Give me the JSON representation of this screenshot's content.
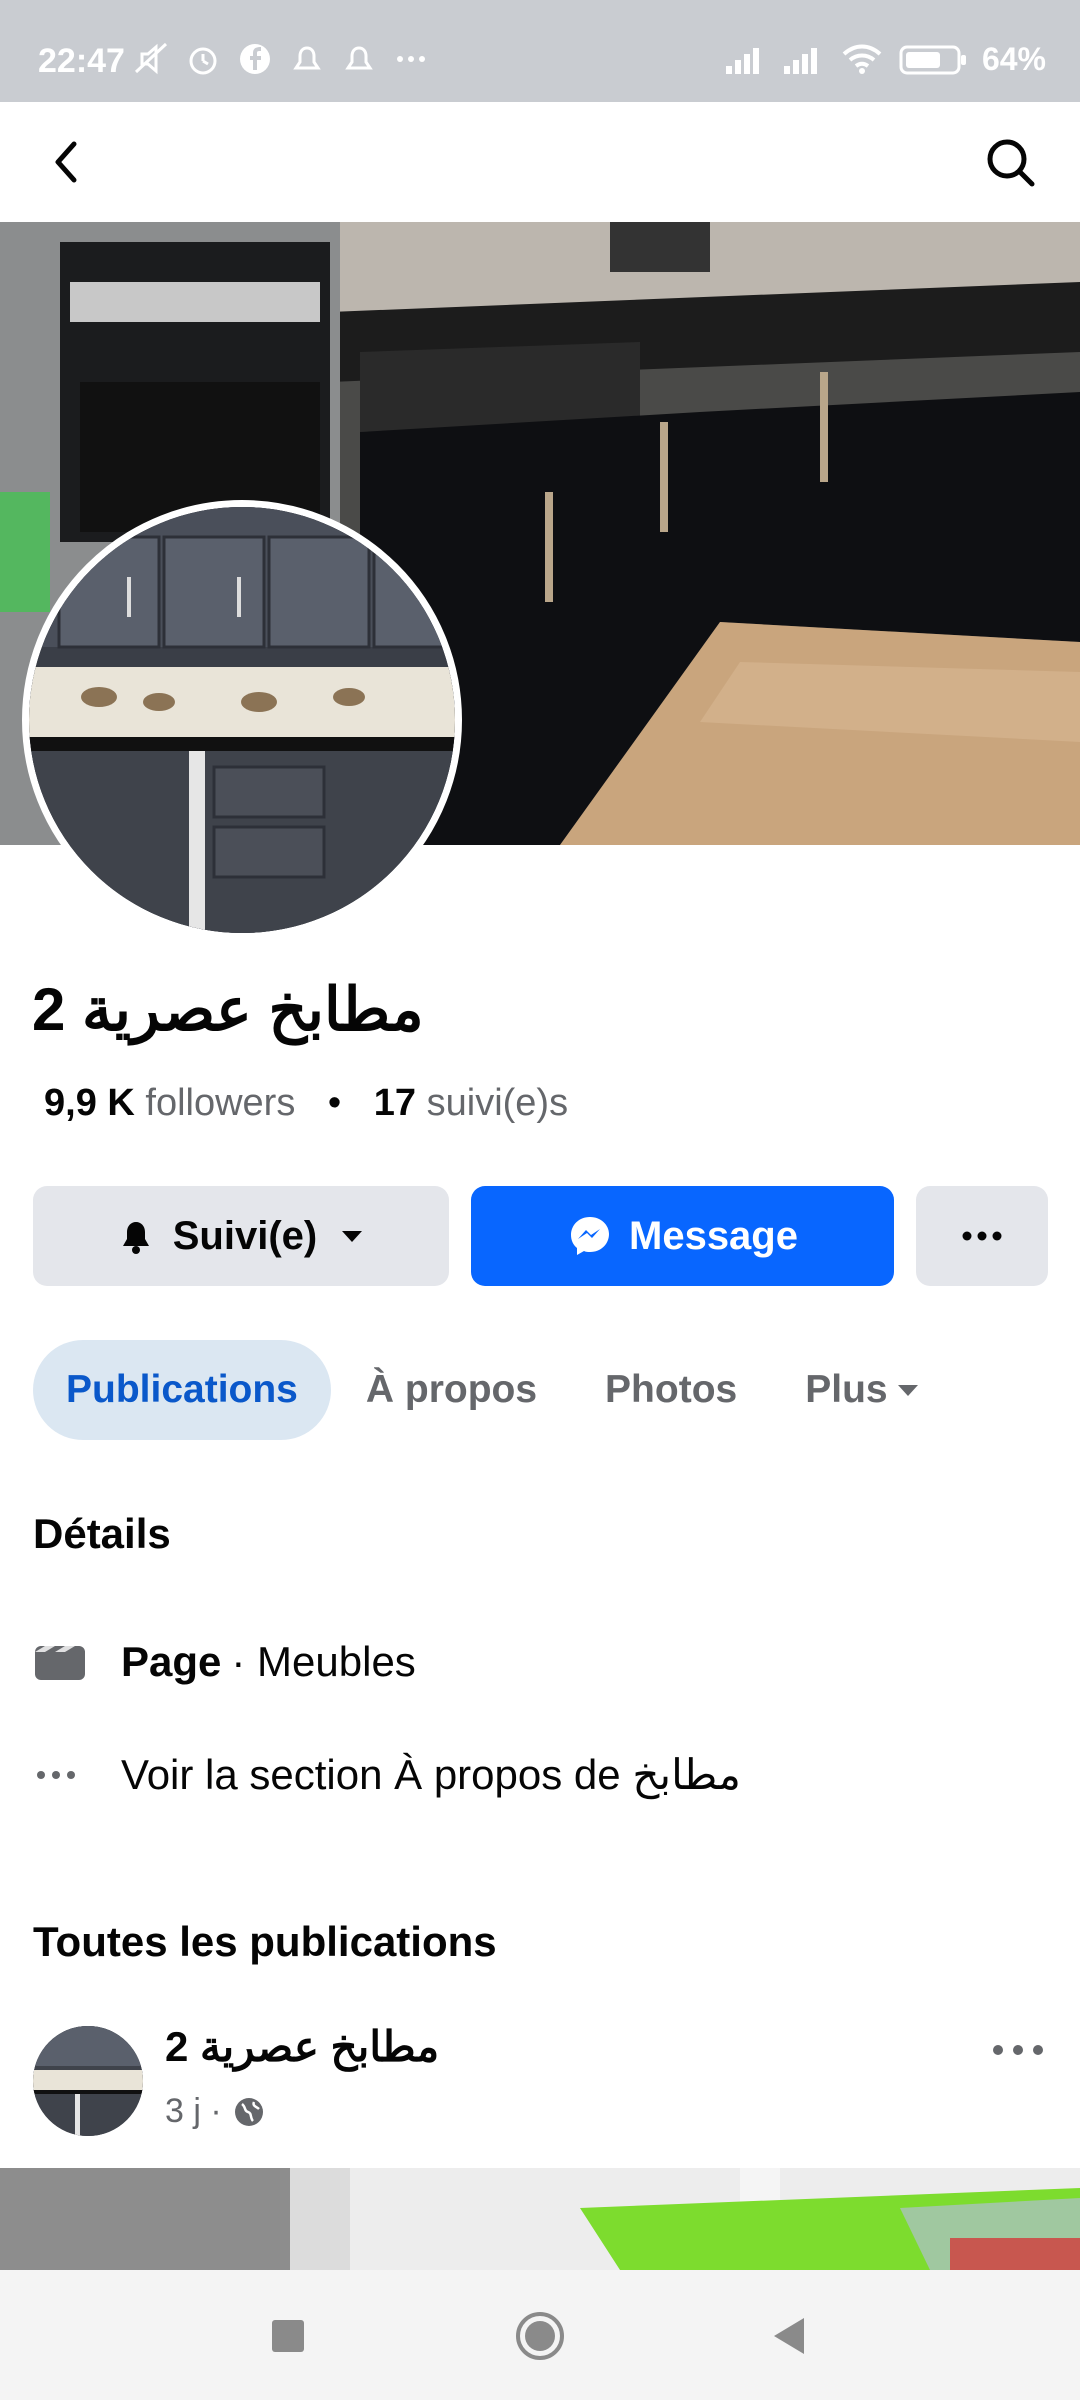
{
  "status_bar": {
    "time": "22:47",
    "battery": "64"
  },
  "appbar": {
    "back_icon": "back-arrow-icon",
    "search_icon": "search-icon"
  },
  "page": {
    "name": "مطابخ عصرية 2",
    "followers_count": "9,9 K",
    "followers_label": "followers",
    "following_count": "17",
    "following_label": "suivi(e)s"
  },
  "actions": {
    "follow_label": "Suivi(e)",
    "message_label": "Message"
  },
  "tabs": [
    "Publications",
    "À propos",
    "Photos",
    "Plus"
  ],
  "details": {
    "title": "Détails",
    "category_bold": "Page",
    "category_rest": "· Meubles",
    "about_link": "Voir la section À propos de مطابخ"
  },
  "posts": {
    "title": "Toutes les publications",
    "author": "مطابخ عصرية 2",
    "time": "3 j ·"
  },
  "colors": {
    "accent": "#0866ff",
    "active_tab_bg": "#dbe7f2",
    "button_gray": "#e4e6eb"
  }
}
